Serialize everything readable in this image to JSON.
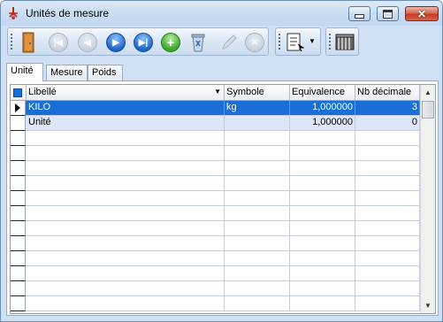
{
  "window": {
    "title": "Unités de mesure"
  },
  "tabs": [
    {
      "label": "Unité"
    },
    {
      "label": "Mesure"
    },
    {
      "label": "Poids"
    }
  ],
  "table": {
    "columns": [
      "Libellé",
      "Symbole",
      "Equivalence",
      "Nb décimale"
    ],
    "rows": [
      {
        "libelle": "KILO",
        "symbole": "kg",
        "equivalence": "1,000000",
        "nb_decimale": "3"
      },
      {
        "libelle": "Unité",
        "symbole": "",
        "equivalence": "1,000000",
        "nb_decimale": "0"
      }
    ]
  },
  "colors": {
    "selection": "#1a6fd6",
    "alt_row": "#dde6f6",
    "chrome": "#cfe0f3"
  },
  "icons": [
    "door-exit-icon",
    "first-record-icon",
    "previous-record-icon",
    "next-record-icon",
    "last-record-icon",
    "add-icon",
    "delete-icon",
    "edit-icon",
    "cancel-icon",
    "report-icon",
    "dropdown-icon",
    "filing-cabinet-icon"
  ]
}
